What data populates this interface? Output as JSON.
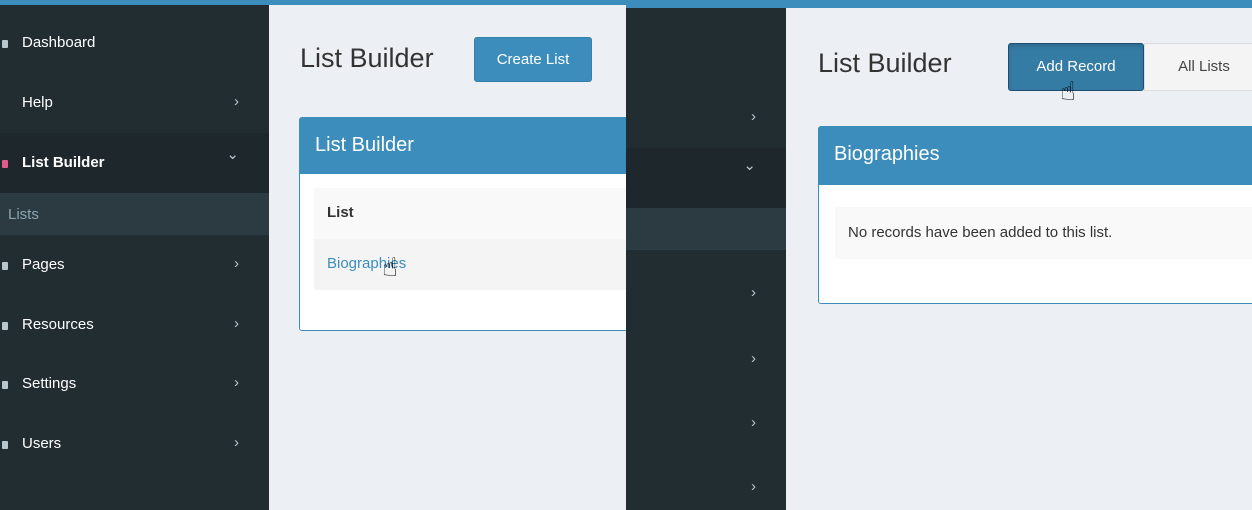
{
  "left": {
    "sidebar": [
      {
        "label": "Dashboard",
        "chevron": ""
      },
      {
        "label": "Help",
        "chevron": "›"
      },
      {
        "label": "List Builder",
        "chevron": "⌄"
      },
      {
        "label": "Pages",
        "chevron": "›"
      },
      {
        "label": "Resources",
        "chevron": "›"
      },
      {
        "label": "Settings",
        "chevron": "›"
      },
      {
        "label": "Users",
        "chevron": "›"
      }
    ],
    "sub_item": "Lists",
    "page_title": "List Builder",
    "create_button": "Create List",
    "box_title": "List Builder",
    "table_header": "List",
    "table_link": "Biographies"
  },
  "right": {
    "sidebar_chevrons": [
      "›",
      "⌄",
      "›",
      "›",
      "›",
      "›"
    ],
    "page_title": "List Builder",
    "add_record_button": "Add Record",
    "all_lists_button": "All Lists",
    "box_title": "Biographies",
    "empty_message": "No records have been added to this list."
  },
  "colors": {
    "accent": "#3c8dbc",
    "sidebar_bg": "#222d32",
    "content_bg": "#ecf0f5"
  },
  "icons": {
    "cursor": "hand-pointer-icon"
  }
}
